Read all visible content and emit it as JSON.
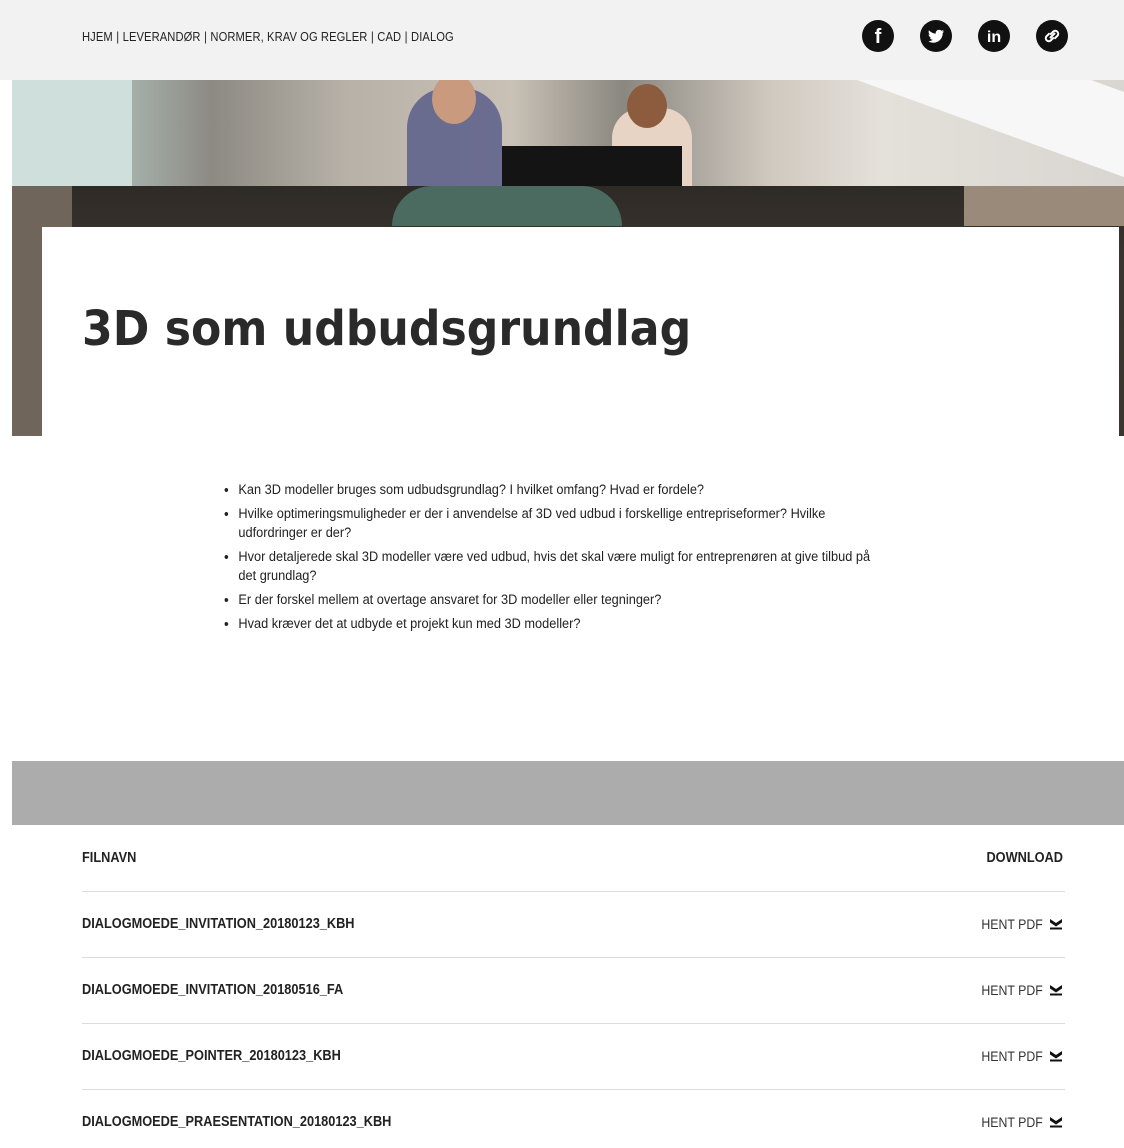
{
  "nav": {
    "items": [
      "HJEM",
      "LEVERANDØR",
      "NORMER, KRAV OG REGLER",
      "CAD",
      "DIALOG"
    ],
    "separator": "|"
  },
  "social": [
    {
      "name": "facebook-icon",
      "glyph": "f"
    },
    {
      "name": "twitter-icon",
      "glyph": "twitter"
    },
    {
      "name": "linkedin-icon",
      "glyph": "in"
    },
    {
      "name": "link-icon",
      "glyph": "link"
    }
  ],
  "main": {
    "title": "3D som udbudsgrundlag",
    "bullets": [
      "Kan 3D modeller bruges som udbudsgrundlag? I hvilket omfang? Hvad er fordele?",
      "Hvilke optimeringsmuligheder er der i anvendelse af 3D ved udbud i forskellige entrepriseformer? Hvilke udfordringer er der?",
      "Hvor detaljerede skal 3D modeller være ved udbud, hvis det skal være muligt for entreprenøren at give tilbud på det grundlag?",
      "Er der forskel mellem at overtage ansvaret for 3D modeller eller tegninger?",
      "Hvad kræver det at udbyde et projekt kun med 3D modeller?"
    ]
  },
  "files": {
    "header_name": "FILNAVN",
    "header_download": "DOWNLOAD",
    "rows": [
      {
        "name": "DIALOGMOEDE_INVITATION_20180123_KBH",
        "action": "HENT PDF"
      },
      {
        "name": "DIALOGMOEDE_INVITATION_20180516_FA",
        "action": "HENT PDF"
      },
      {
        "name": "DIALOGMOEDE_POINTER_20180123_KBH",
        "action": "HENT PDF"
      },
      {
        "name": "DIALOGMOEDE_PRAESENTATION_20180123_KBH",
        "action": "HENT PDF"
      }
    ]
  }
}
